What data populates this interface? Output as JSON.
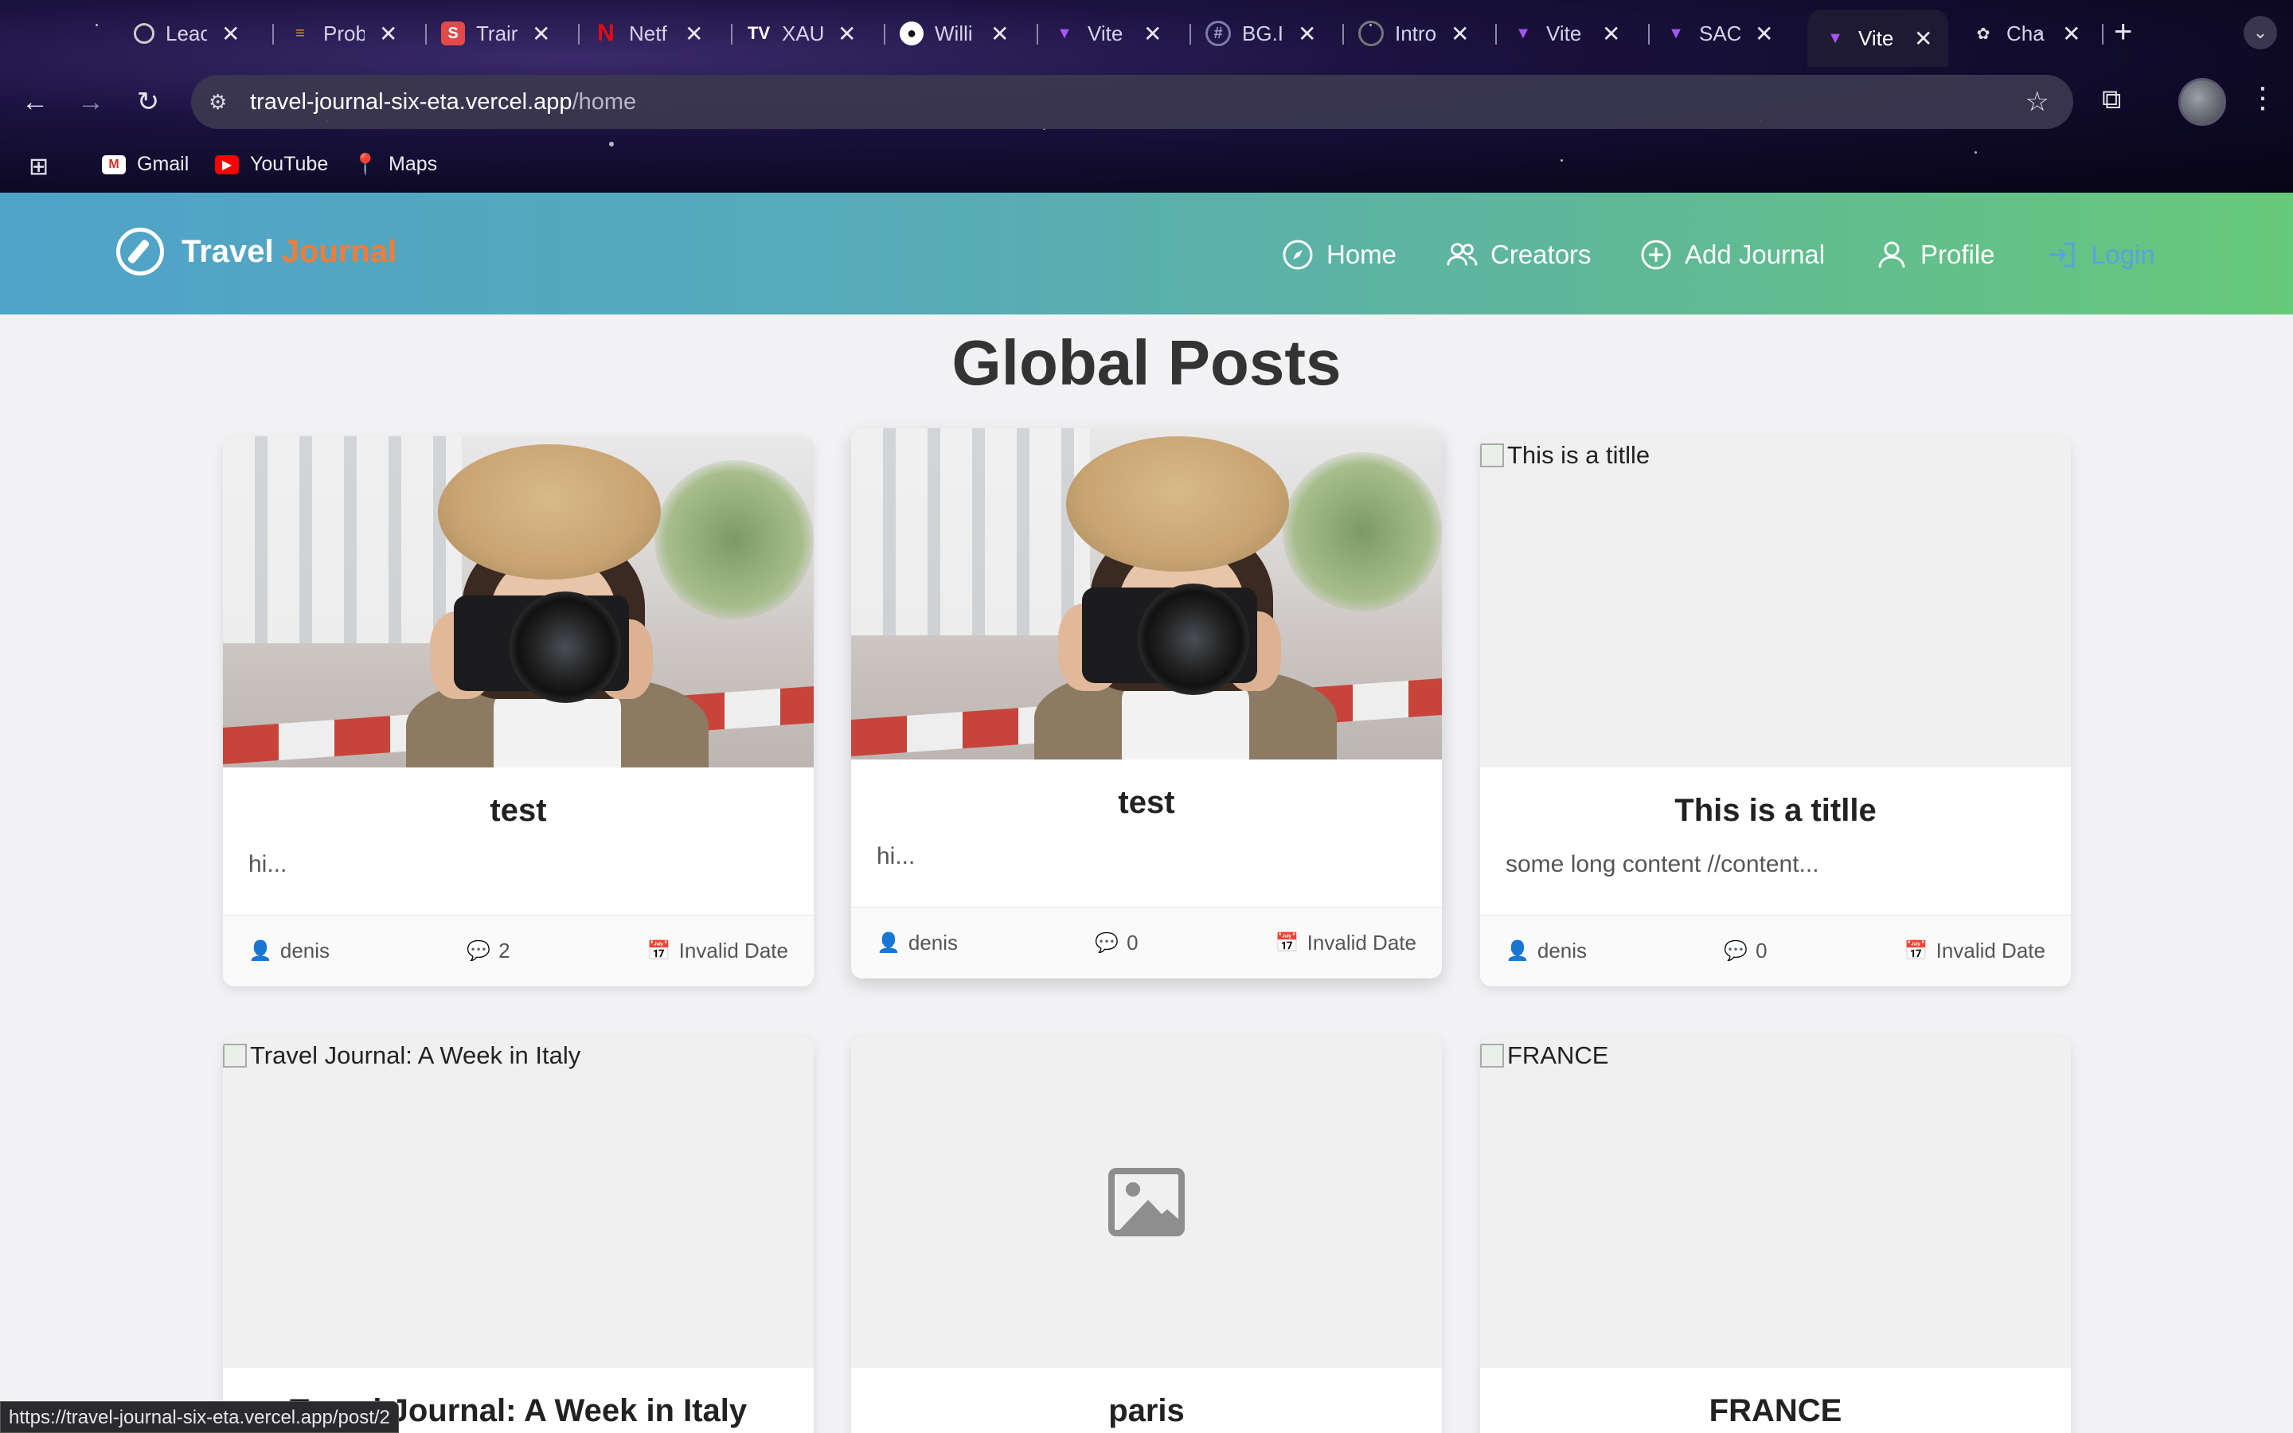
{
  "browser": {
    "tabs": [
      {
        "title": "Leac",
        "icon": "leetcode-icon",
        "color": "#222222"
      },
      {
        "title": "Prob",
        "icon": "codeforces-icon",
        "color": "#e08a2c"
      },
      {
        "title": "Trair",
        "icon": "trainer-icon",
        "color": "#e24a4a"
      },
      {
        "title": "Netf",
        "icon": "netflix-icon",
        "color": "#e50914"
      },
      {
        "title": "XAU",
        "icon": "tradingview-icon",
        "color": "#ffffff"
      },
      {
        "title": "Willi",
        "icon": "github-icon",
        "color": "#ffffff"
      },
      {
        "title": "Vite",
        "icon": "vite-icon",
        "color": "#a855f7"
      },
      {
        "title": "BG.I",
        "icon": "hashtag-icon",
        "color": "#7c7ca8"
      },
      {
        "title": "Intro",
        "icon": "intro-icon",
        "color": "#555555"
      },
      {
        "title": "Vite",
        "icon": "vite-icon",
        "color": "#a855f7"
      },
      {
        "title": "SAC",
        "icon": "vite-icon",
        "color": "#a855f7"
      },
      {
        "title": "Vite",
        "icon": "vite-icon",
        "color": "#a855f7",
        "active": true
      },
      {
        "title": "Cha",
        "icon": "chatgpt-icon",
        "color": "#dddddd"
      }
    ],
    "url_host": "travel-journal-six-eta.vercel.app",
    "url_path": "/home",
    "bookmarks": [
      {
        "label": "Gmail",
        "icon": "gmail-icon"
      },
      {
        "label": "YouTube",
        "icon": "youtube-icon"
      },
      {
        "label": "Maps",
        "icon": "maps-icon"
      }
    ],
    "status_url": "https://travel-journal-six-eta.vercel.app/post/2"
  },
  "app": {
    "brand_part1": "Travel",
    "brand_part2": "Journal",
    "accent_color": "#ef7d3a",
    "nav": {
      "home": "Home",
      "creators": "Creators",
      "add_journal": "Add Journal",
      "profile": "Profile",
      "login": "Login"
    }
  },
  "main": {
    "title": "Global Posts",
    "posts": [
      {
        "title": "test",
        "excerpt": "hi...",
        "author": "denis",
        "comments": "2",
        "date": "Invalid Date",
        "image": "photo"
      },
      {
        "title": "test",
        "excerpt": "hi...",
        "author": "denis",
        "comments": "0",
        "date": "Invalid Date",
        "image": "photo"
      },
      {
        "title": "This is a titlle",
        "excerpt": "some long content //content...",
        "author": "denis",
        "comments": "0",
        "date": "Invalid Date",
        "image": "broken",
        "alt": "This is a titlle"
      },
      {
        "title": "Travel Journal: A Week in Italy",
        "alt": "Travel Journal: A Week in Italy",
        "image": "broken"
      },
      {
        "title": "paris",
        "image": "placeholder"
      },
      {
        "title": "FRANCE",
        "alt": "FRANCE",
        "image": "broken"
      }
    ]
  }
}
